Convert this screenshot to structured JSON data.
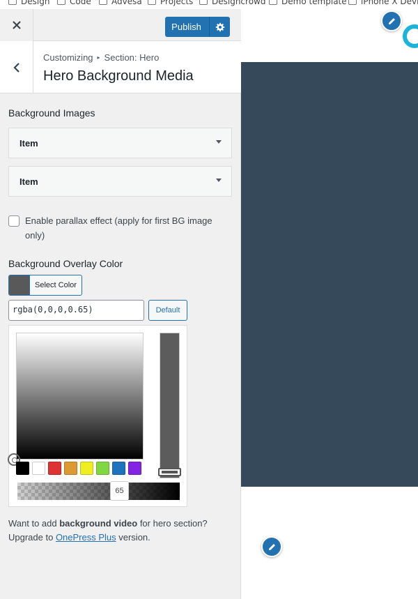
{
  "bookmarks": [
    "Design",
    "Code",
    "Advesa",
    "Projects",
    "Designcrowd",
    "Demo template",
    "iPhone X Device"
  ],
  "toolbar": {
    "publish_label": "Publish"
  },
  "section": {
    "breadcrumb_root": "Customizing",
    "breadcrumb_section": "Section: Hero",
    "title": "Hero Background Media"
  },
  "background_images": {
    "label": "Background Images",
    "items": [
      "Item",
      "Item"
    ]
  },
  "parallax": {
    "label": "Enable parallax effect (apply for first BG image only)",
    "checked": false
  },
  "overlay": {
    "label": "Background Overlay Color",
    "select_color_label": "Select Color",
    "value": "rgba(0,0,0,0.65)",
    "default_label": "Default",
    "alpha_value": "65",
    "swatch_color": "#595959",
    "palette": [
      "#000000",
      "#ffffff",
      "#dd3333",
      "#dd9933",
      "#eeee22",
      "#81d742",
      "#1e73be",
      "#8224e3"
    ]
  },
  "upsell": {
    "before": "Want to add ",
    "bold": "background video",
    "middle": " for hero section?",
    "line2": "Upgrade to ",
    "link": "OnePress Plus",
    "after": " version."
  },
  "preview": {
    "hero_color": "#35495a",
    "accent": "#2271b1"
  }
}
